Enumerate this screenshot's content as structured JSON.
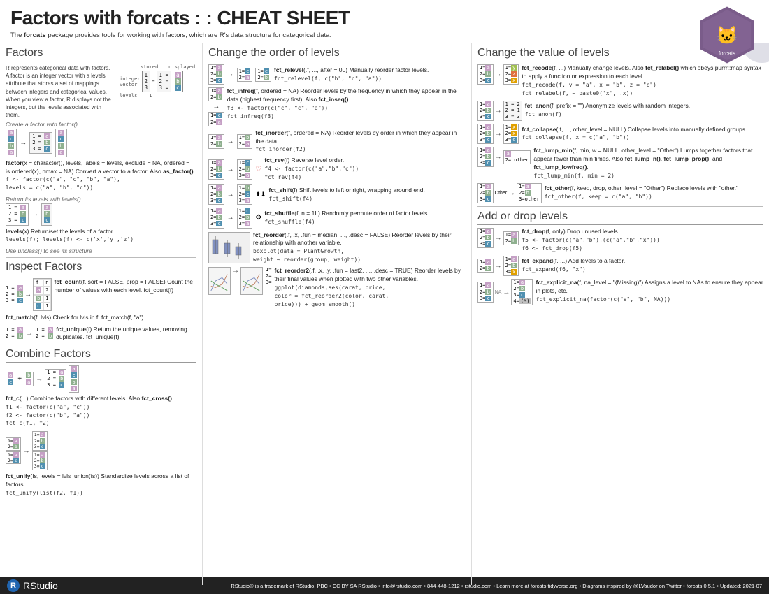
{
  "header": {
    "title_light": "Factors with forcats : : ",
    "title_bold": "CHEAT SHEET",
    "subtitle": "The ",
    "subtitle_bold": "forcats",
    "subtitle_rest": " package provides tools for working with factors, which are R's data structure for categorical data."
  },
  "logo": {
    "alt": "forcats hex logo"
  },
  "sections": {
    "factors": {
      "title": "Factors",
      "intro": "R represents categorical data with factors. A factor is an integer vector with a levels attribute that stores a set of mappings between integers and categorical values. When you view a factor, R displays not the integers, but the levels associated with them.",
      "stored_label": "stored",
      "displayed_label": "displayed",
      "create_label": "Create a factor with factor()",
      "factor_func": "factor(x = character(), levels, labels = levels, exclude = NA, ordered = is.ordered(x), nmax = NA) Convert a vector to a factor. Also as_factor().",
      "factor_example": "f <- factor(c(\"a\", \"c\", \"b\", \"a\"),\n  levels = c(\"a\", \"b\", \"c\"))",
      "levels_label": "Return its levels with levels()",
      "levels_func": "levels(x) Return/set the levels of a factor.",
      "levels_example": "levels(f); levels(f) <- c('x','y','z')",
      "unclass_label": "Use unclass() to see its structure"
    },
    "inspect": {
      "title": "Inspect Factors",
      "fct_count": "fct_count(f, sort = FALSE, prop = FALSE) Count the number of values with each level. fct_count(f)",
      "fct_match": "fct_match(f, lvls) Check for lvls in f. fct_match(f, \"a\")",
      "fct_unique": "fct_unique(f) Return the unique values, removing duplicates. fct_unique(f)"
    },
    "combine": {
      "title": "Combine Factors",
      "fct_c": "fct_c(...) Combine factors with different levels. Also fct_cross().\nf1 <- factor(c(\"a\", \"c\"))\nf2 <- factor(c(\"b\", \"a\"))\nfct_c(f1, f2)",
      "fct_unify": "fct_unify(fs, levels = lvls_union(fs)) Standardize levels across a list of factors.\nfct_unify(list(f2, f1))"
    },
    "change_order": {
      "title": "Change the order of levels",
      "fct_relevel": {
        "name": "fct_relevel",
        "sig": "fct_relevel(.f, ..., after = 0L)",
        "desc": "Manually reorder factor levels.",
        "example": "fct_relevel(f, c(\"b\", \"c\", \"a\"))"
      },
      "fct_infreq": {
        "name": "fct_infreq",
        "sig": "fct_infreq(f, ordered = NA)",
        "desc": "Reorder levels by the frequency in which they appear in the data (highest frequency first). Also fct_inseq().",
        "example": "f3 <- factor(c(\"c\", \"c\", \"a\"))\nfct_infreq(f3)"
      },
      "fct_inorder": {
        "name": "fct_inorder",
        "sig": "fct_inorder(f, ordered = NA)",
        "desc": "Reorder levels by order in which they appear in the data.",
        "example": "fct_inorder(f2)"
      },
      "fct_rev": {
        "name": "fct_rev",
        "sig": "fct_rev(f) Reverse level order.",
        "example": "f4 <- factor(c(\"a\",\"b\",\"c\"))\nfct_rev(f4)"
      },
      "fct_shift": {
        "name": "fct_shift",
        "sig": "fct_shift(f) Shift levels to left or right, wrapping around end.",
        "example": "fct_shift(f4)"
      },
      "fct_shuffle": {
        "name": "fct_shuffle",
        "sig": "fct_shuffle(f, n = 1L) Randomly permute order of factor levels.",
        "example": "fct_shuffle(f4)"
      },
      "fct_reorder": {
        "name": "fct_reorder",
        "sig": "fct_reorder(.f, .x, .fun = median, ..., .desc = FALSE) Reorder levels by their relationship with another variable.",
        "example": "boxplot(data = PlantGrowth,\n  weight ~ reorder(group, weight))"
      },
      "fct_reorder2": {
        "name": "fct_reorder2",
        "sig": "fct_reorder2(.f, .x, .y, .fun = last2, ..., .desc = TRUE) Reorder levels by their final values when plotted with two other variables.",
        "example": "ggplot(diamonds,aes(carat, price,\n  color = fct_reorder2(color, carat,\n  price))) + geom_smooth()"
      }
    },
    "change_value": {
      "title": "Change the value of levels",
      "fct_recode": {
        "name": "fct_recode",
        "sig": "fct_recode(f, ...) Manually change levels. Also fct_relabel() which obeys purrr::map syntax to apply a function or expression to each level.",
        "example": "fct_recode(f, v = \"a\", x = \"b\", z = \"c\")\nfct_relabel(f, ~ paste0('x', .x))"
      },
      "fct_anon": {
        "name": "fct_anon",
        "sig": "fct_anon(f, prefix = \"\") Anonymize levels with random integers.",
        "example": "fct_anon(f)"
      },
      "fct_collapse": {
        "name": "fct_collapse",
        "sig": "fct_collapse(.f, ..., other_level = NULL) Collapse levels into manually defined groups.",
        "example": "fct_collapse(f, x = c(\"a\", \"b\"))"
      },
      "fct_lump_min": {
        "name": "fct_lump_min",
        "sig": "fct_lump_min(f, min, w = NULL, other_level = \"Other\") Lumps together factors that appear fewer than min times. Also fct_lump_n(), fct_lump_prop(), and fct_lump_lowfreq().",
        "example": "fct_lump_min(f, min = 2)"
      },
      "fct_other": {
        "name": "fct_other",
        "sig": "fct_other(f, keep, drop, other_level = \"Other\") Replace levels with \"other.\"",
        "example": "fct_other(f, keep = c(\"a\", \"b\"))"
      }
    },
    "add_drop": {
      "title": "Add or drop levels",
      "fct_drop": {
        "name": "fct_drop",
        "sig": "fct_drop(f, only) Drop unused levels.",
        "example": "f5 <- factor(c(\"a\",\"b\"),(c(\"a\",\"b\",\"x\"))\nf6 <- fct_drop(f5)"
      },
      "fct_expand": {
        "name": "fct_expand",
        "sig": "fct_expand(f, ...) Add levels to a factor.",
        "example": "fct_expand(f6, \"x\")"
      },
      "fct_explicit_na": {
        "name": "fct_explicit_na",
        "sig": "fct_explicit_na(f, na_level = \"(Missing)\") Assigns a level to NAs to ensure they appear in plots, etc.",
        "example": "fct_explicit_na(factor(c(\"a\", \"b\", NA)))"
      }
    }
  },
  "footer": {
    "rstudio_label": "RStudio",
    "trademark": "RStudio® is a trademark of RStudio, PBC",
    "license": "CC BY SA RStudio",
    "email": "info@rstudio.com",
    "phone": "844-448-1212",
    "website": "rstudio.com",
    "learn": "Learn more at forcats.tidyverse.org",
    "diagrams": "Diagrams inspired by @LVaudor on Twitter",
    "package": "forcats 0.5.1",
    "updated": "Updated: 2021-07"
  }
}
